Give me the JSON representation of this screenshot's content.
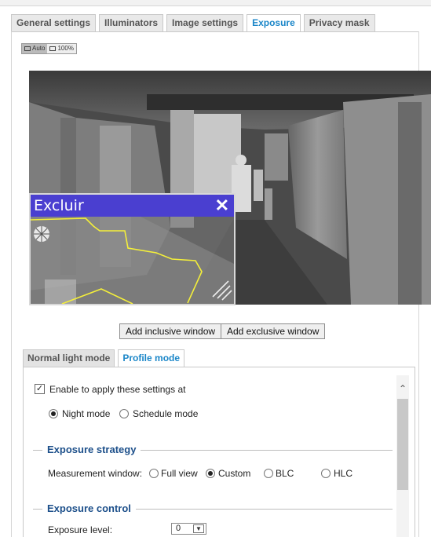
{
  "tabs": [
    {
      "label": "General settings",
      "active": false
    },
    {
      "label": "Illuminators",
      "active": false
    },
    {
      "label": "Image settings",
      "active": false
    },
    {
      "label": "Exposure",
      "active": true
    },
    {
      "label": "Privacy mask",
      "active": false
    }
  ],
  "zoom": {
    "auto_label": "Auto",
    "full_label": "100%",
    "selected": "Auto"
  },
  "exclude_window": {
    "title": "Excluir",
    "close_glyph": "✕"
  },
  "buttons": {
    "add_inclusive": "Add inclusive window",
    "add_exclusive": "Add exclusive window"
  },
  "mode_tabs": [
    {
      "label": "Normal light mode",
      "active": false
    },
    {
      "label": "Profile mode",
      "active": true
    }
  ],
  "profile": {
    "enable_label": "Enable to apply these settings at",
    "enable_checked": true,
    "night_mode_label": "Night mode",
    "schedule_mode_label": "Schedule mode",
    "selected_mode": "Night mode"
  },
  "exposure_strategy": {
    "title": "Exposure strategy",
    "measurement_label": "Measurement window:",
    "options": [
      "Full view",
      "Custom",
      "BLC",
      "HLC"
    ],
    "selected": "Custom"
  },
  "exposure_control": {
    "title": "Exposure control",
    "level_label": "Exposure level:",
    "level_value": "0"
  },
  "icons": {
    "checkbox": "checkmark-icon",
    "scroll_up": "chevron-up-icon",
    "dropdown": "chevron-down-icon"
  }
}
